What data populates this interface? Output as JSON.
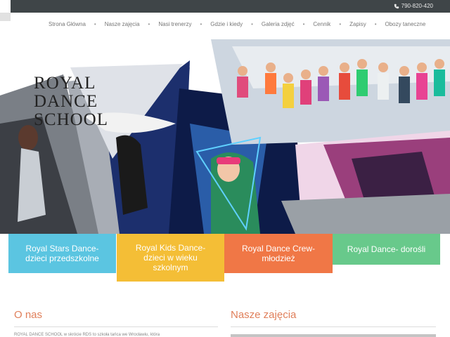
{
  "topbar": {
    "phone": "790-820-420",
    "phone_icon": "phone-icon"
  },
  "nav": {
    "items": [
      {
        "label": "Strona Główna"
      },
      {
        "label": "Nasze zajęcia"
      },
      {
        "label": "Nasi trenerzy"
      },
      {
        "label": "Gdzie i kiedy"
      },
      {
        "label": "Galeria zdjęć"
      },
      {
        "label": "Cennik"
      },
      {
        "label": "Zapisy"
      },
      {
        "label": "Obozy taneczne"
      }
    ],
    "separator": "•"
  },
  "logo": {
    "line1": "ROYAL",
    "line2": "DANCE",
    "line3": "SCHOOL"
  },
  "cards": [
    {
      "line1": "Royal Stars Dance-",
      "line2": "dzieci przedszkolne",
      "line3": "",
      "color": "#5bc5e1"
    },
    {
      "line1": "Royal Kids Dance-",
      "line2": "dzieci w wieku",
      "line3": "szkolnym",
      "color": "#f4be36"
    },
    {
      "line1": "Royal Dance Crew-",
      "line2": "młodzież",
      "line3": "",
      "color": "#f07746"
    },
    {
      "line1": "Royal Dance- dorośli",
      "line2": "",
      "line3": "",
      "color": "#68c98b"
    }
  ],
  "sections": {
    "about_title": "O nas",
    "classes_title": "Nasze zajęcia",
    "about_snippet": "ROYAL DANCE SCHOOL w skrócie RDS to szkoła tańca we Wrocławiu, która"
  },
  "colors": {
    "accent": "#e07f5a",
    "topbar": "#3f4548"
  }
}
